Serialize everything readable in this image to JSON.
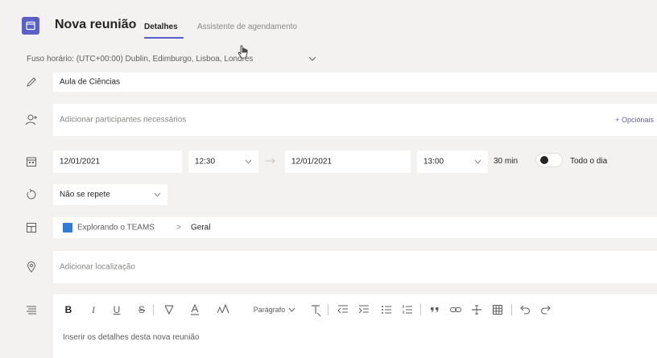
{
  "header": {
    "title": "Nova reunião",
    "tabs": [
      {
        "label": "Detalhes",
        "active": true
      },
      {
        "label": "Assistente de agendamento",
        "active": false
      }
    ]
  },
  "timezone": {
    "label": "Fuso horário: (UTC+00:00) Dublin, Edimburgo, Lisboa, Londres"
  },
  "form": {
    "title_value": "Aula de Ciências",
    "attendees_placeholder": "Adicionar participantes necessários",
    "options_link": "+ Opcionais",
    "start_date": "12/01/2021",
    "start_time": "12:30",
    "end_date": "12/01/2021",
    "end_time": "13:00",
    "duration": "30 min",
    "all_day_label": "Todo o dia",
    "all_day_on": false,
    "repeat": "Não se repete",
    "channel": {
      "team": "Explorando o TEAMS",
      "separator": ">",
      "name": "Geral"
    },
    "location_placeholder": "Adicionar localização",
    "editor": {
      "paragraph_label": "Parágrafo",
      "placeholder": "Inserir os detalhes desta nova reunião"
    }
  },
  "colors": {
    "accent": "#5b5fc7",
    "background": "#f3f2f1",
    "field": "#ffffff"
  },
  "icons": {
    "app": "calendar-icon",
    "title": "pencil-icon",
    "attendees": "add-person-icon",
    "datetime": "calendar-icon",
    "repeat": "repeat-icon",
    "channel": "channel-grid-icon",
    "location": "location-pin-icon",
    "details": "text-lines-icon"
  }
}
